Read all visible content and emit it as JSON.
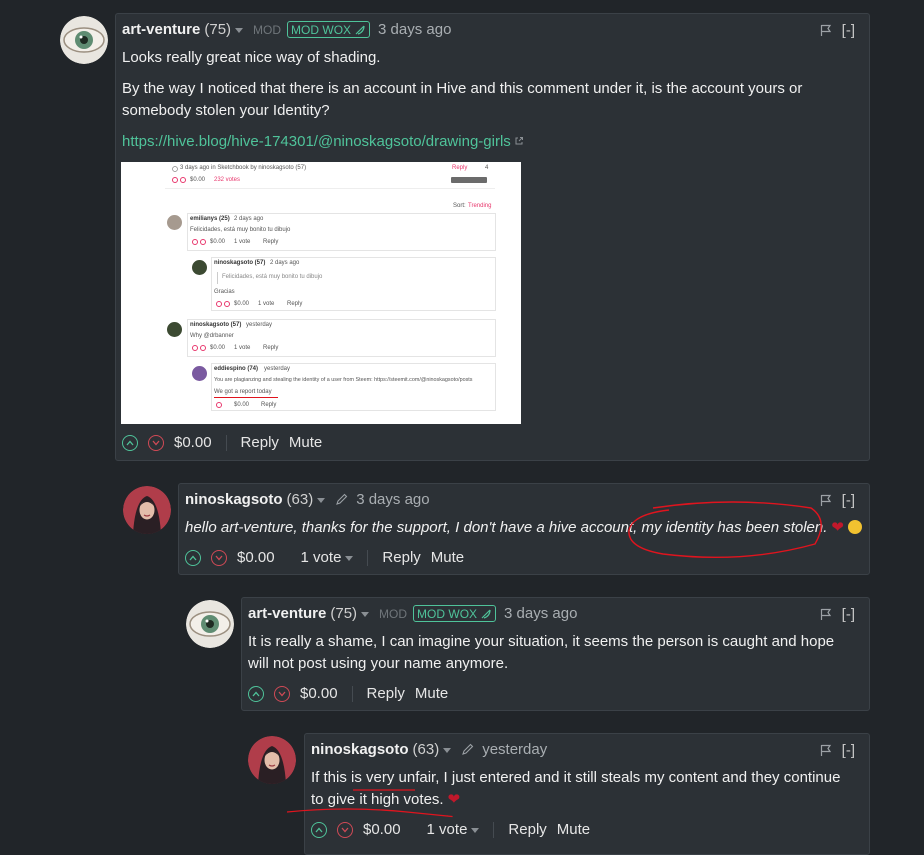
{
  "comments": [
    {
      "author": "art-venture",
      "rep": "(75)",
      "mod": "MOD",
      "badge": "MOD WOX",
      "time": "3 days ago",
      "paragraphs": [
        "Looks really great nice way of shading.",
        "By the way I noticed that there is an account in Hive and this comment under it, is the account yours or somebody stolen your Identity?"
      ],
      "link": "https://hive.blog/hive-174301/@ninoskagsoto/drawing-girls",
      "payout": "$0.00",
      "reply": "Reply",
      "mute": "Mute",
      "collapse": "[-]"
    },
    {
      "author": "ninoskagsoto",
      "rep": "(63)",
      "time": "3 days ago",
      "text": "hello art-venture, thanks for the support, I don't have a hive account, my identity has been stolen.",
      "payout": "$0.00",
      "votes": "1 vote",
      "reply": "Reply",
      "mute": "Mute",
      "collapse": "[-]"
    },
    {
      "author": "art-venture",
      "rep": "(75)",
      "mod": "MOD",
      "badge": "MOD WOX",
      "time": "3 days ago",
      "text": "It is really a shame, I can imagine your situation, it seems the person is caught and hope will not post using your name anymore.",
      "payout": "$0.00",
      "reply": "Reply",
      "mute": "Mute",
      "collapse": "[-]"
    },
    {
      "author": "ninoskagsoto",
      "rep": "(63)",
      "time": "yesterday",
      "text": "If this is very unfair, I just entered and it still steals my content and they continue to give it high votes.",
      "payout": "$0.00",
      "votes": "1 vote",
      "reply": "Reply",
      "mute": "Mute",
      "collapse": "[-]"
    }
  ],
  "embedded": {
    "top_line": "3 days ago in Sketchbook by ninoskagsoto (57)",
    "top_reply": "Reply",
    "top_count": "4",
    "top_payout": "$0.00",
    "top_votes": "232 votes",
    "sort_label": "Sort:",
    "sort_value": "Trending",
    "c1_author": "emilianys (25)",
    "c1_time": "2 days ago",
    "c1_text": "Felicidades, está muy bonito tu dibujo",
    "c1_payout": "$0.00",
    "c1_votes": "1 vote",
    "c1_reply": "Reply",
    "c2_author": "ninoskagsoto (57)",
    "c2_time": "2 days ago",
    "c2_quote": "Felicidades, está muy bonito tu dibujo",
    "c2_text": "Gracias",
    "c2_payout": "$0.00",
    "c2_votes": "1 vote",
    "c2_reply": "Reply",
    "c3_author": "ninoskagsoto (57)",
    "c3_time": "yesterday",
    "c3_text": "Why @drbanner",
    "c3_payout": "$0.00",
    "c3_votes": "1 vote",
    "c3_reply": "Reply",
    "c4_author": "eddiespino (74)",
    "c4_time": "yesterday",
    "c4_text": "You are plagianzing and stealing the identity of a user from Steem: https://steemit.com/@ninoskagsoto/posts",
    "c4_text2": "We got a report today",
    "c4_payout": "$0.00",
    "c4_reply": "Reply"
  },
  "colors": {
    "background": "#212529",
    "card": "#2c3136",
    "accent_green": "#4fc39a",
    "downvote_red": "#d04a56",
    "annotation_red": "#e0141e"
  }
}
